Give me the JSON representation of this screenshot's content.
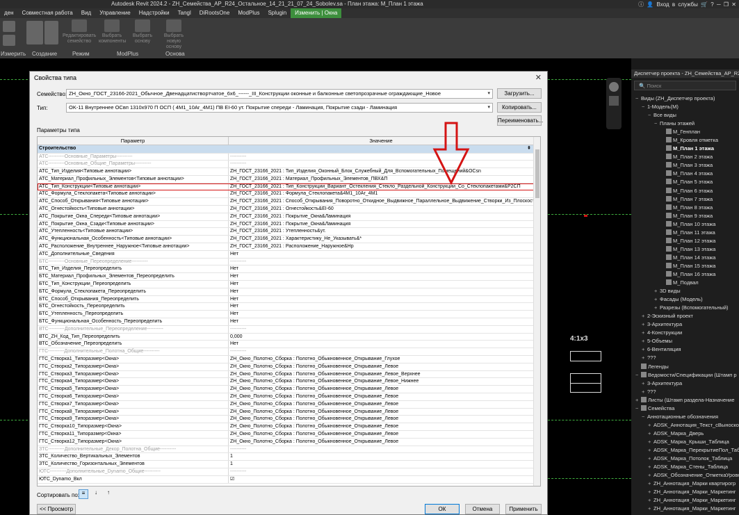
{
  "app": {
    "title": "Autodesk Revit 2024.2 - ZH_Семейства_АР_R24_Остальное_14_21_21_07_24_Sobolev.sa - План этажа: М_План 1 этажа",
    "login": "Вход в службы"
  },
  "menu": [
    "ден",
    "Совместная работа",
    "Вид",
    "Управление",
    "Надстройки",
    "Tangl",
    "DiRootsOne",
    "ModPlus",
    "Splugin",
    "Изменить | Окна"
  ],
  "ribbon": {
    "groups": [
      "Измерить",
      "Создание",
      "Режим",
      "ModPlus",
      "Основа"
    ],
    "buttons": [
      "Редактировать семейство",
      "Выбрать компоненты",
      "Выбрать основу",
      "Выбрать новую основу"
    ]
  },
  "dialog": {
    "title": "Свойства типа",
    "family_label": "Семейство:",
    "family_value": "ZH_Окно_ГОСТ_23166-2021_Обычное_Двенадцатиствортчатое_6х6_------_III_Конструкции оконные и балконные светопрозрачные ограждающие_Новое",
    "type_label": "Тип:",
    "type_value": "OK-11 Внутреннее ОСвп 1310х970 П ОСП ( 4М1_10Ar_4М1) ПВ EI-60 ут.  Покрытие спереди - Ламинация, Покрытие сзади - Ламинация",
    "load_btn": "Загрузить...",
    "copy_btn": "Копировать...",
    "rename_btn": "Переименовать...",
    "params_label": "Параметры типа",
    "col_param": "Параметр",
    "col_value": "Значение",
    "group_name": "Строительство",
    "sort_label": "Сортировать по:",
    "preview_btn": "<< Просмотр",
    "ok_btn": "ОК",
    "cancel_btn": "Отмена",
    "apply_btn": "Применить"
  },
  "rows": [
    {
      "p": "АТС----------Основные_Параметры----------",
      "v": "----------",
      "sep": true
    },
    {
      "p": "АТС----------Основные_Общие_Параметры----------",
      "v": "----------",
      "sep": true
    },
    {
      "p": "АТС_Тип_Изделия<Типовые аннотации>",
      "v": "ZH_ГОСТ_23166_2021 : Тип_Изделия_Оконный_Блок_Служебный_Для_Вспомогательных_Помещений&OCsn"
    },
    {
      "p": "АТС_Материал_Профильных_Элементов<Типовые аннотации>",
      "v": "ZH_ГОСТ_23166_2021 : Материал_Профильных_Элементов_ПВХ&П"
    },
    {
      "p": "АТС_Тип_Конструкции<Типовые аннотации>",
      "v": "ZH_ГОСТ_23166_2021 : Тип_Конструкции_Вариант_Остекления_Стекло_Раздельной_Конструкции_Со_Стеклопакетами&Р2СП",
      "hl": true
    },
    {
      "p": "АТС_Формула_Стеклопакета<Типовые аннотации>",
      "v": "ZH_ГОСТ_23166_2021 : Формула_Стеклопакета&4М1_10Ar_4М1"
    },
    {
      "p": "АТС_Способ_Открывания<Типовые аннотации>",
      "v": "ZH_ГОСТ_23166_2021 : Способ_Открывания_Поворотно_Откидное_Выдвижное_Параллельное_Выдвижение_Створки_Из_Плоскости_Ок"
    },
    {
      "p": "АТС_Огнестойкость<Типовые аннотации>",
      "v": "ZH_ГОСТ_23166_2021 : Огнестойкость&EI-60"
    },
    {
      "p": "АТС_Покрытие_Окна_Спереди<Типовые аннотации>",
      "v": "ZH_ГОСТ_23166_2021 : Покрытие_Окна&Ламинация"
    },
    {
      "p": "АТС_Покрытие_Окна_Сзади<Типовые аннотации>",
      "v": "ZH_ГОСТ_23166_2021 : Покрытие_Окна&Ламинация"
    },
    {
      "p": "АТС_Утепленность<Типовые аннотации>",
      "v": "ZH_ГОСТ_23166_2021 : Утепленность&ут."
    },
    {
      "p": "АТС_Функциональная_Особенность<Типовые аннотации>",
      "v": "ZH_ГОСТ_23166_2021 : Характеристику_Не_Указывать&*"
    },
    {
      "p": "АТС_Расположение_Внутреннее_Наружное<Типовые аннотации>",
      "v": "ZH_ГОСТ_23166_2021 : Расположение_Наружное&Нр"
    },
    {
      "p": "АТС_Дополнительные_Сведения",
      "v": "Нет"
    },
    {
      "p": "БТС----------Основные_Переопределение----------",
      "v": "----------",
      "sep": true
    },
    {
      "p": "БТС_Тип_Изделия_Переопределить",
      "v": "Нет"
    },
    {
      "p": "БТС_Материал_Профильных_Элементов_Переопределить",
      "v": "Нет"
    },
    {
      "p": "БТС_Тип_Конструкции_Переопределить",
      "v": "Нет"
    },
    {
      "p": "БТС_Формула_Стеклопакета_Переопределить",
      "v": "Нет"
    },
    {
      "p": "БТС_Способ_Открывания_Переопределить",
      "v": "Нет"
    },
    {
      "p": "БТС_Огнестойкость_Переопределить",
      "v": "Нет"
    },
    {
      "p": "БТС_Утепленность_Переопределить",
      "v": "Нет"
    },
    {
      "p": "БТС_Функциональная_Особенность_Переопределить",
      "v": "Нет"
    },
    {
      "p": "ВТС----------Дополнительные_Переопределение----------",
      "v": "----------",
      "sep": true
    },
    {
      "p": "ВТС_ZH_Код_Тип_Переопределить",
      "v": "0,000"
    },
    {
      "p": "ВТС_Обозначение_Переопределить",
      "v": "Нет"
    },
    {
      "p": "ГТС----------Дополнительные_Полотна_Общие----------",
      "v": "----------",
      "sep": true
    },
    {
      "p": "ГТС_Створка1_Типоразмер<Окна>",
      "v": "ZH_Окно_Полотно_Сборка : Полотно_Обыкновенное_Открывание_Глухое"
    },
    {
      "p": "ГТС_Створка2_Типоразмер<Окна>",
      "v": "ZH_Окно_Полотно_Сборка : Полотно_Обыкновенное_Открывание_Левое"
    },
    {
      "p": "ГТС_Створка3_Типоразмер<Окна>",
      "v": "ZH_Окно_Полотно_Сборка : Полотно_Обыкновенное_Открывание_Левое_Верхнее"
    },
    {
      "p": "ГТС_Створка4_Типоразмер<Окна>",
      "v": "ZH_Окно_Полотно_Сборка : Полотно_Обыкновенное_Открывание_Левое_Нижнее"
    },
    {
      "p": "ГТС_Створка5_Типоразмер<Окна>",
      "v": "ZH_Окно_Полотно_Сборка : Полотно_Обыкновенное_Открывание_Левое"
    },
    {
      "p": "ГТС_Створка6_Типоразмер<Окна>",
      "v": "ZH_Окно_Полотно_Сборка : Полотно_Обыкновенное_Открывание_Левое"
    },
    {
      "p": "ГТС_Створка7_Типоразмер<Окна>",
      "v": "ZH_Окно_Полотно_Сборка : Полотно_Обыкновенное_Открывание_Левое"
    },
    {
      "p": "ГТС_Створка8_Типоразмер<Окна>",
      "v": "ZH_Окно_Полотно_Сборка : Полотно_Обыкновенное_Открывание_Левое"
    },
    {
      "p": "ГТС_Створка9_Типоразмер<Окна>",
      "v": "ZH_Окно_Полотно_Сборка : Полотно_Обыкновенное_Открывание_Левое"
    },
    {
      "p": "ГТС_Створка10_Типоразмер<Окна>",
      "v": "ZH_Окно_Полотно_Сборка : Полотно_Обыкновенное_Открывание_Левое"
    },
    {
      "p": "ГТС_Створка11_Типоразмер<Окна>",
      "v": "ZH_Окно_Полотно_Сборка : Полотно_Обыкновенное_Открывание_Левое"
    },
    {
      "p": "ГТС_Створка12_Типоразмер<Окна>",
      "v": "ZH_Окно_Полотно_Сборка : Полотно_Обыкновенное_Открывание_Левое"
    },
    {
      "p": "ЗТС----------Дополнительные_Декор_Полотна_Общие----------",
      "v": "----------",
      "sep": true
    },
    {
      "p": "ЗТС_Количество_Вертикальных_Элементов",
      "v": "1"
    },
    {
      "p": "ЗТС_Количество_Горизонтальных_Элементов",
      "v": "1"
    },
    {
      "p": "ЮТС----------Дополнительные_Dynamo_Общие----------",
      "v": "----------",
      "sep": true
    },
    {
      "p": "ЮТС_Dynamo_Вкл",
      "v": "☑"
    }
  ],
  "browser": {
    "title": "Диспетчер проекта - ZH_Семейства_АР_R24_Оста",
    "search_placeholder": "Поиск",
    "items": [
      {
        "t": "Виды (ZH_Диспетчер проекта)",
        "i": 0,
        "g": "−"
      },
      {
        "t": "1-Модель(М)",
        "i": 1,
        "g": "−"
      },
      {
        "t": "Все виды",
        "i": 2,
        "g": "−"
      },
      {
        "t": "Планы этажей",
        "i": 3,
        "g": "−"
      },
      {
        "t": "М_Генплан",
        "i": 4,
        "b": 1
      },
      {
        "t": "М_Кровля отметка",
        "i": 4,
        "b": 1
      },
      {
        "t": "М_План 1 этажа",
        "i": 4,
        "b": 1,
        "bold": 1
      },
      {
        "t": "М_План 2 этажа",
        "i": 4,
        "b": 1
      },
      {
        "t": "М_План 3 этажа",
        "i": 4,
        "b": 1
      },
      {
        "t": "М_План 4 этажа",
        "i": 4,
        "b": 1
      },
      {
        "t": "М_План 5 этажа",
        "i": 4,
        "b": 1
      },
      {
        "t": "М_План 6 этажа",
        "i": 4,
        "b": 1
      },
      {
        "t": "М_План 7 этажа",
        "i": 4,
        "b": 1
      },
      {
        "t": "М_План 8 этажа",
        "i": 4,
        "b": 1
      },
      {
        "t": "М_План 9 этажа",
        "i": 4,
        "b": 1
      },
      {
        "t": "М_План 10 этажа",
        "i": 4,
        "b": 1
      },
      {
        "t": "М_План 11 этажа",
        "i": 4,
        "b": 1
      },
      {
        "t": "М_План 12 этажа",
        "i": 4,
        "b": 1
      },
      {
        "t": "М_План 13 этажа",
        "i": 4,
        "b": 1
      },
      {
        "t": "М_План 14 этажа",
        "i": 4,
        "b": 1
      },
      {
        "t": "М_План 15 этажа",
        "i": 4,
        "b": 1
      },
      {
        "t": "М_План 16 этажа",
        "i": 4,
        "b": 1
      },
      {
        "t": "М_Подвал",
        "i": 4,
        "b": 1
      },
      {
        "t": "3D виды",
        "i": 3,
        "g": "+"
      },
      {
        "t": "Фасады (Модель)",
        "i": 3,
        "g": "+"
      },
      {
        "t": "Разрезы (Вспомогательный)",
        "i": 3,
        "g": "+"
      },
      {
        "t": "2-Эскизный проект",
        "i": 1,
        "g": "+"
      },
      {
        "t": "3-Архитектура",
        "i": 1,
        "g": "+"
      },
      {
        "t": "4-Конструкции",
        "i": 1,
        "g": "+"
      },
      {
        "t": "5-Объемы",
        "i": 1,
        "g": "+"
      },
      {
        "t": "6-Вентиляция",
        "i": 1,
        "g": "+"
      },
      {
        "t": "???",
        "i": 1,
        "g": "+"
      },
      {
        "t": "Легенды",
        "i": 0,
        "b": 1
      },
      {
        "t": "Ведомости/Спецификации (Штамп р",
        "i": 0,
        "g": "−",
        "b": 1
      },
      {
        "t": "3-Архитектура",
        "i": 1,
        "g": "+"
      },
      {
        "t": "???",
        "i": 1,
        "g": "+"
      },
      {
        "t": "Листы (Штамп раздела-Назначение",
        "i": 0,
        "g": "+",
        "b": 1
      },
      {
        "t": "Семейства",
        "i": 0,
        "g": "−",
        "b": 1
      },
      {
        "t": "Аннотационные обозначения",
        "i": 1,
        "g": "−"
      },
      {
        "t": "ADSK_Аннотация_Текст_сВыноской",
        "i": 2,
        "g": "+"
      },
      {
        "t": "ADSK_Марка_Дверь",
        "i": 2,
        "g": "+"
      },
      {
        "t": "ADSK_Марка_Крыши_Таблица",
        "i": 2,
        "g": "+"
      },
      {
        "t": "ADSK_Марка_ПерекрытиеПол_Таб",
        "i": 2,
        "g": "+"
      },
      {
        "t": "ADSK_Марка_Потолок_Таблица",
        "i": 2,
        "g": "+"
      },
      {
        "t": "ADSK_Марка_Стены_Таблица",
        "i": 2,
        "g": "+"
      },
      {
        "t": "ADSK_Обозначение_ОтметкаУровн",
        "i": 2,
        "g": "+"
      },
      {
        "t": "ZH_Аннотация_Марки квартирогр",
        "i": 2,
        "g": "+"
      },
      {
        "t": "ZH_Аннотация_Марки_Маркетинг",
        "i": 2,
        "g": "+"
      },
      {
        "t": "ZH_Аннотация_Марки_Маркетинг",
        "i": 2,
        "g": "+"
      },
      {
        "t": "ZH_Аннотация_Марки_Маркетинг",
        "i": 2,
        "g": "+"
      }
    ]
  },
  "canvas": {
    "scale_label": "4:1x3"
  },
  "colors": {
    "highlight": "#d41414",
    "accent": "#3d8f3d",
    "group_bg": "#c9dcee"
  }
}
